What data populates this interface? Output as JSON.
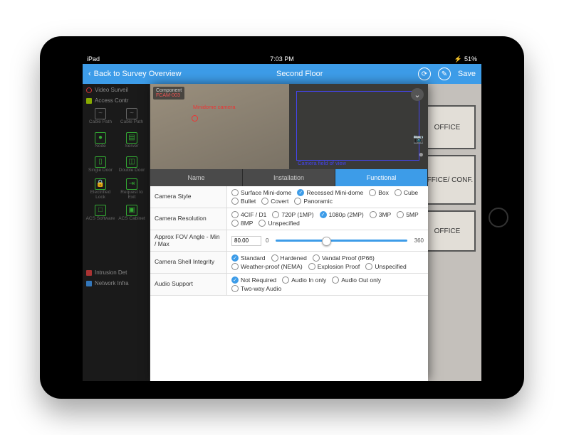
{
  "status": {
    "device": "iPad",
    "time": "7:03 PM",
    "battery": "51%"
  },
  "nav": {
    "back": "Back to Survey Overview",
    "title": "Second Floor",
    "save": "Save"
  },
  "sidebar": {
    "video": {
      "label": "Video Surveil"
    },
    "access": {
      "label": "Access Contr"
    },
    "items": [
      {
        "label": "Cable Path"
      },
      {
        "label": "Cable Path"
      },
      {
        "label": "Node"
      },
      {
        "label": "Server"
      },
      {
        "label": "Single Door"
      },
      {
        "label": "Double Door"
      },
      {
        "label": "Electrified Lock"
      },
      {
        "label": "Request to Exit"
      },
      {
        "label": "ACS Software"
      },
      {
        "label": "ACS Cabinet"
      }
    ],
    "intrusion": "Intrusion Det",
    "network": "Network Infra"
  },
  "floorplan": {
    "rooms": [
      {
        "label": "OFFICE"
      },
      {
        "label": "OFFICE/ CONF."
      },
      {
        "label": "OFFICE"
      }
    ]
  },
  "modal": {
    "component_label": "Component",
    "component_id": "FCAM-003",
    "minidome": "Minidome camera",
    "fov_label": "Camera field of view",
    "tabs": [
      "Name",
      "Installation",
      "Functional"
    ],
    "rows": [
      {
        "label": "Camera Style",
        "options": [
          {
            "t": "Surface Mini-dome",
            "s": 0
          },
          {
            "t": "Recessed Mini-dome",
            "s": 1
          },
          {
            "t": "Box",
            "s": 0
          },
          {
            "t": "Cube",
            "s": 0
          },
          {
            "t": "Bullet",
            "s": 0
          },
          {
            "t": "Covert",
            "s": 0
          },
          {
            "t": "Panoramic",
            "s": 0
          }
        ]
      },
      {
        "label": "Camera Resolution",
        "options": [
          {
            "t": "4CIF / D1",
            "s": 0
          },
          {
            "t": "720P (1MP)",
            "s": 0
          },
          {
            "t": "1080p (2MP)",
            "s": 1
          },
          {
            "t": "3MP",
            "s": 0
          },
          {
            "t": "5MP",
            "s": 0
          },
          {
            "t": "8MP",
            "s": 0
          },
          {
            "t": "Unspecified",
            "s": 0
          }
        ]
      },
      {
        "label": "Approx FOV Angle - Min / Max",
        "fov": {
          "value": "80.00",
          "min": "0",
          "max": "360"
        }
      },
      {
        "label": "Camera Shell Integrity",
        "options": [
          {
            "t": "Standard",
            "s": 1
          },
          {
            "t": "Hardened",
            "s": 0
          },
          {
            "t": "Vandal Proof  (IP66)",
            "s": 0
          },
          {
            "t": "Weather-proof (NEMA)",
            "s": 0
          },
          {
            "t": "Explosion Proof",
            "s": 0
          },
          {
            "t": "Unspecified",
            "s": 0
          }
        ]
      },
      {
        "label": "Audio Support",
        "options": [
          {
            "t": "Not Required",
            "s": 1
          },
          {
            "t": "Audio In only",
            "s": 0
          },
          {
            "t": "Audio Out only",
            "s": 0
          },
          {
            "t": "Two-way Audio",
            "s": 0
          }
        ]
      }
    ]
  }
}
